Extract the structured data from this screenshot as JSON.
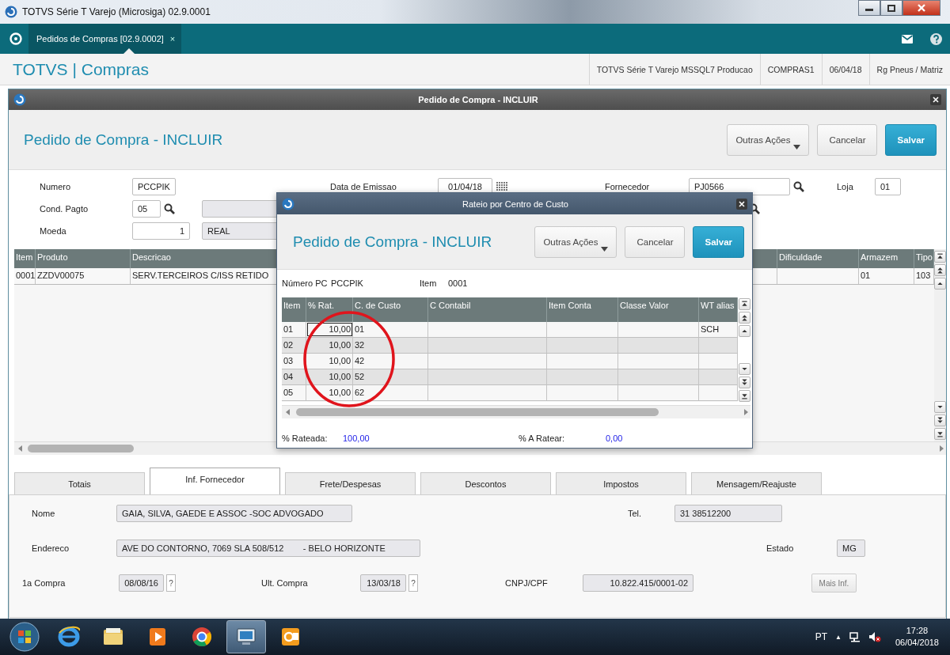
{
  "window": {
    "title": "TOTVS Série T Varejo (Microsiga) 02.9.0001"
  },
  "app_tabs": [
    {
      "label": "Pedidos de Compras [02.9.0002]",
      "close": "×",
      "selected": true
    }
  ],
  "app_header": {
    "brand": "TOTVS | Compras",
    "info": [
      "TOTVS Série T Varejo MSSQL7 Producao",
      "COMPRAS1",
      "06/04/18",
      "Rg Pneus / Matriz"
    ]
  },
  "order_window": {
    "title": "Pedido de Compra - INCLUIR",
    "heading": "Pedido de Compra - INCLUIR",
    "buttons": [
      {
        "label": "Outras Ações",
        "kind": "menu"
      },
      {
        "label": "Cancelar",
        "kind": "default"
      },
      {
        "label": "Salvar",
        "kind": "primary"
      }
    ],
    "field_rows": [
      [
        {
          "label": "Numero",
          "value": "PCCPIK",
          "kind": "text"
        },
        {
          "label": "Data de Emissao",
          "value": "01/04/18",
          "kind": "date"
        },
        {
          "label": "Fornecedor",
          "value": "PJ0566",
          "kind": "lookup"
        },
        {
          "label": "Loja",
          "value": "01",
          "kind": "text"
        }
      ],
      [
        {
          "label": "Cond. Pagto",
          "value": "05",
          "kind": "lookup"
        },
        {
          "kind": "readonly"
        },
        {
          "kind": "search"
        }
      ],
      [
        {
          "label": "Moeda",
          "value": "1",
          "kind": "number"
        },
        {
          "kind": "readonly",
          "value": "REAL"
        }
      ]
    ],
    "items_table": {
      "columns": [
        "Item",
        "Produto",
        "Descricao",
        null,
        "Dificuldade",
        "Armazem",
        "Tipo"
      ],
      "rows": [
        {
          "cells": [
            "0001",
            "ZZDV00075",
            "SERV.TERCEIROS C/ISS RETIDO",
            null,
            null,
            "01",
            "103"
          ]
        }
      ]
    }
  },
  "supplier_tabs": [
    {
      "label": "Totais",
      "selected": false
    },
    {
      "label": "Inf. Fornecedor",
      "selected": true
    },
    {
      "label": "Frete/Despesas",
      "selected": false
    },
    {
      "label": "Descontos",
      "selected": false
    },
    {
      "label": "Impostos",
      "selected": false
    },
    {
      "label": "Mensagem/Reajuste",
      "selected": false
    }
  ],
  "supplier_panel": {
    "fields": [
      {
        "label": "Nome",
        "value": "GAIA, SILVA, GAEDE E ASSOC -SOC ADVOGADO"
      },
      {
        "label": "Tel.",
        "value": "31 38512200"
      },
      {
        "label": "Endereco",
        "value": "AVE DO CONTORNO, 7069 SLA 508/512        - BELO HORIZONTE"
      },
      {
        "label": "Estado",
        "value": "MG"
      },
      {
        "label": "1a Compra",
        "value": "08/08/16",
        "help": "?"
      },
      {
        "label": "Ult. Compra",
        "value": "13/03/18",
        "help": "?"
      },
      {
        "label": "CNPJ/CPF",
        "value": "10.822.415/0001-02"
      },
      {
        "kind": "button",
        "label": "Mais Inf."
      }
    ]
  },
  "cost_split": {
    "title": "Rateio por Centro de Custo",
    "heading": "Pedido de Compra - INCLUIR",
    "buttons": [
      {
        "label": "Outras Ações",
        "kind": "menu"
      },
      {
        "label": "Cancelar",
        "kind": "default"
      },
      {
        "label": "Salvar",
        "kind": "primary"
      }
    ],
    "info": [
      {
        "label": "Número PC",
        "value": "PCCPIK"
      },
      {
        "label": "Item",
        "value": "0001"
      }
    ],
    "table": {
      "columns": [
        "Item",
        "% Rat.",
        "C. de Custo",
        "C Contabil",
        "Item Conta",
        "Classe Valor",
        "WT alias"
      ],
      "rows": [
        {
          "cells": [
            "01",
            "10,00",
            "01",
            null,
            null,
            null,
            "SCH"
          ],
          "focused": true
        },
        {
          "cells": [
            "02",
            "10,00",
            "32",
            null,
            null,
            null,
            null
          ],
          "focused": false
        },
        {
          "cells": [
            "03",
            "10,00",
            "42",
            null,
            null,
            null,
            null
          ],
          "focused": false
        },
        {
          "cells": [
            "04",
            "10,00",
            "52",
            null,
            null,
            null,
            null
          ],
          "focused": false
        },
        {
          "cells": [
            "05",
            "10,00",
            "62",
            null,
            null,
            null,
            null
          ],
          "focused": false
        }
      ]
    },
    "totals": [
      {
        "label": "% Rateada:",
        "value": "100,00"
      },
      {
        "label": "% A Ratear:",
        "value": "0,00"
      }
    ]
  },
  "taskbar": {
    "language": "PT",
    "tray_arrow": "▲",
    "time": "17:28",
    "date": "06/04/2018"
  }
}
